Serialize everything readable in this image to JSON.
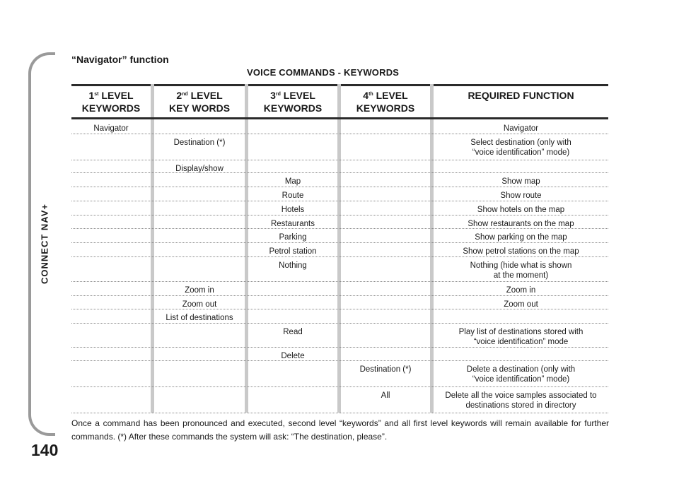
{
  "sidebar": {
    "label": "CONNECT NAV+"
  },
  "page_number": "140",
  "section_title": "“Navigator” function",
  "table_title": "VOICE COMMANDS - KEYWORDS",
  "headers": [
    {
      "num": "1",
      "sup": "st",
      "line1": "LEVEL",
      "line2": "KEYWORDS"
    },
    {
      "num": "2",
      "sup": "nd",
      "line1": "LEVEL",
      "line2": "KEY WORDS"
    },
    {
      "num": "3",
      "sup": "rd",
      "line1": "LEVEL",
      "line2": "KEYWORDS"
    },
    {
      "num": "4",
      "sup": "th",
      "line1": "LEVEL",
      "line2": "KEYWORDS"
    },
    {
      "text": "REQUIRED FUNCTION"
    }
  ],
  "rows": [
    {
      "c1": "Navigator",
      "c2": "",
      "c3": "",
      "c4": "",
      "c5": [
        "Navigator"
      ]
    },
    {
      "c1": "",
      "c2": "Destination (*)",
      "c3": "",
      "c4": "",
      "c5": [
        "Select destination (only with",
        "“voice identification” mode)"
      ]
    },
    {
      "c1": "",
      "c2": "Display/show",
      "c3": "",
      "c4": "",
      "c5": [
        ""
      ]
    },
    {
      "c1": "",
      "c2": "",
      "c3": "Map",
      "c4": "",
      "c5": [
        "Show map"
      ]
    },
    {
      "c1": "",
      "c2": "",
      "c3": "Route",
      "c4": "",
      "c5": [
        "Show route"
      ]
    },
    {
      "c1": "",
      "c2": "",
      "c3": "Hotels",
      "c4": "",
      "c5": [
        "Show hotels on the map"
      ]
    },
    {
      "c1": "",
      "c2": "",
      "c3": "Restaurants",
      "c4": "",
      "c5": [
        "Show restaurants on the map"
      ]
    },
    {
      "c1": "",
      "c2": "",
      "c3": "Parking",
      "c4": "",
      "c5": [
        "Show parking on the map"
      ]
    },
    {
      "c1": "",
      "c2": "",
      "c3": "Petrol station",
      "c4": "",
      "c5": [
        "Show petrol stations on the map"
      ]
    },
    {
      "c1": "",
      "c2": "",
      "c3": "Nothing",
      "c4": "",
      "c5": [
        "Nothing (hide what is shown",
        "at the moment)"
      ]
    },
    {
      "c1": "",
      "c2": "Zoom in",
      "c3": "",
      "c4": "",
      "c5": [
        "Zoom in"
      ]
    },
    {
      "c1": "",
      "c2": "Zoom out",
      "c3": "",
      "c4": "",
      "c5": [
        "Zoom out"
      ]
    },
    {
      "c1": "",
      "c2": "List of destinations",
      "c3": "",
      "c4": "",
      "c5": [
        ""
      ]
    },
    {
      "c1": "",
      "c2": "",
      "c3": "Read",
      "c4": "",
      "c5": [
        "Play list of destinations stored with",
        "“voice identification” mode"
      ]
    },
    {
      "c1": "",
      "c2": "",
      "c3": "Delete",
      "c4": "",
      "c5": [
        ""
      ]
    },
    {
      "c1": "",
      "c2": "",
      "c3": "",
      "c4": "Destination (*)",
      "c5": [
        "Delete a destination (only with",
        "“voice identification” mode)"
      ]
    },
    {
      "c1": "",
      "c2": "",
      "c3": "",
      "c4": "All",
      "c5": [
        "Delete all the voice samples associated to",
        "destinations stored in directory"
      ]
    }
  ],
  "footnote": "Once a command has been pronounced and executed, second level “keywords” and all first level keywords will remain available for further commands. (*) After these commands the system will ask: “The destination, please”."
}
